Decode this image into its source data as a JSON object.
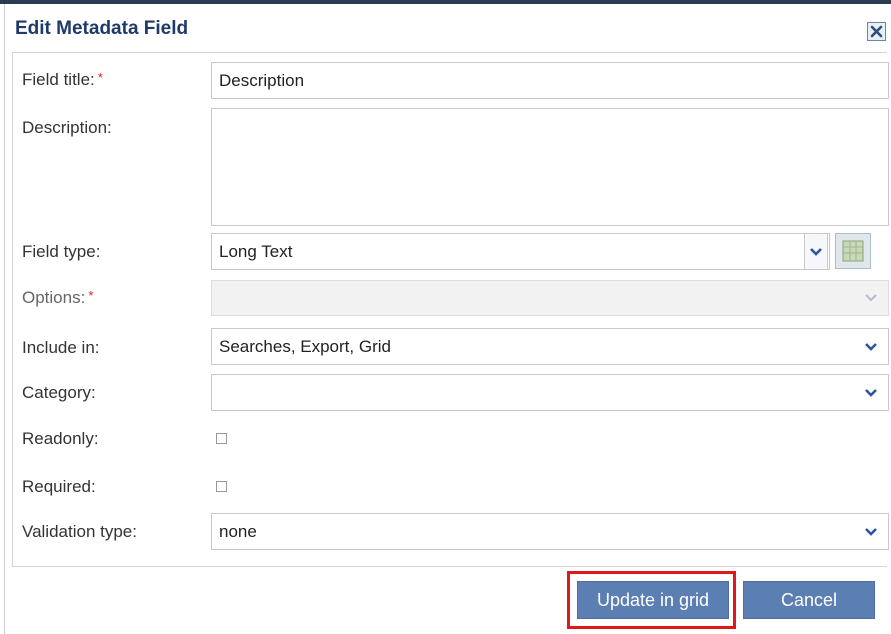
{
  "dialog": {
    "title": "Edit Metadata Field",
    "close_icon": "close-icon"
  },
  "form": {
    "field_title": {
      "label": "Field title:",
      "required_mark": "*",
      "value": "Description"
    },
    "description": {
      "label": "Description:",
      "value": ""
    },
    "field_type": {
      "label": "Field type:",
      "value": "Long Text"
    },
    "options": {
      "label": "Options:",
      "required_mark": "*",
      "value": ""
    },
    "include_in": {
      "label": "Include in:",
      "value": "Searches, Export, Grid"
    },
    "category": {
      "label": "Category:",
      "value": ""
    },
    "readonly": {
      "label": "Readonly:",
      "checked": false
    },
    "required": {
      "label": "Required:",
      "checked": false
    },
    "validation_type": {
      "label": "Validation type:",
      "value": "none"
    }
  },
  "buttons": {
    "update": "Update in grid",
    "cancel": "Cancel"
  },
  "colors": {
    "title": "#1f3a6a",
    "button": "#5b7fb2",
    "highlight": "#e01818",
    "required": "#e02020"
  }
}
